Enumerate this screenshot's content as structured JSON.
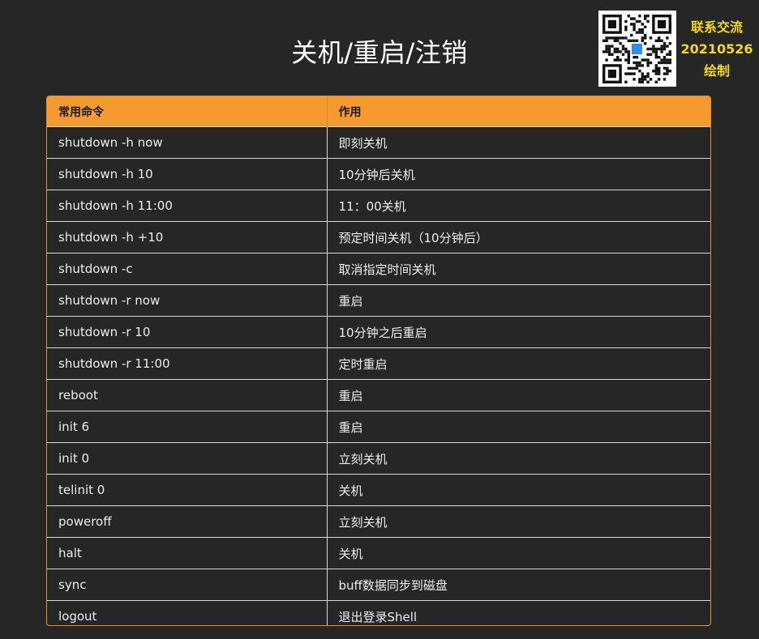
{
  "title": "关机/重启/注销",
  "contact": {
    "line1": "联系交流",
    "line2": "20210526",
    "line3": "绘制"
  },
  "colors": {
    "background": "#262626",
    "header": "#f59a2e",
    "border": "#e8902c",
    "contact_text": "#f2d91a"
  },
  "table": {
    "headers": [
      "常用命令",
      "作用"
    ],
    "rows": [
      [
        "shutdown -h now",
        "即刻关机"
      ],
      [
        "shutdown -h 10",
        "10分钟后关机"
      ],
      [
        "shutdown -h 11:00",
        "11：00关机"
      ],
      [
        "shutdown -h +10",
        "预定时间关机（10分钟后）"
      ],
      [
        "shutdown -c",
        "取消指定时间关机"
      ],
      [
        "shutdown -r now",
        "重启"
      ],
      [
        "shutdown -r 10",
        "10分钟之后重启"
      ],
      [
        "shutdown -r 11:00",
        "定时重启"
      ],
      [
        "reboot",
        "重启"
      ],
      [
        "init 6",
        "重启"
      ],
      [
        "init 0",
        "立刻关机"
      ],
      [
        "telinit 0",
        "关机"
      ],
      [
        "poweroff",
        "立刻关机"
      ],
      [
        "halt",
        "关机"
      ],
      [
        "sync",
        "buff数据同步到磁盘"
      ],
      [
        "logout",
        "退出登录Shell"
      ]
    ]
  }
}
